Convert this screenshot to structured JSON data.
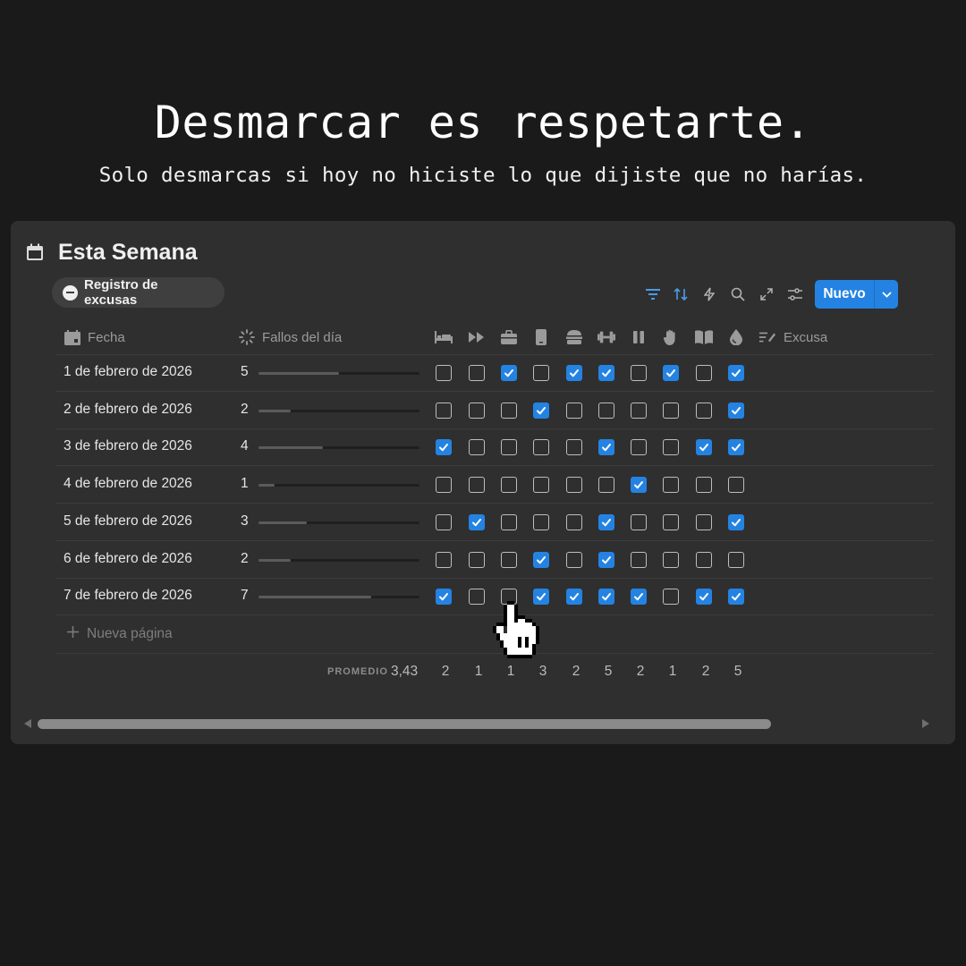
{
  "headline": "Desmarcar es respetarte.",
  "subline": "Solo desmarcas si hoy no hiciste lo que dijiste que no harías.",
  "database": {
    "title": "Esta Semana",
    "view_tab": "Registro de excusas",
    "new_button": "Nuevo",
    "icons": {
      "title": "calendar-icon",
      "view_tab": "minus-circle-icon"
    }
  },
  "toolbar": {
    "icons": [
      "filter-icon",
      "sort-icon",
      "lightning-icon",
      "search-icon",
      "expand-icon",
      "settings-sliders-icon"
    ]
  },
  "columns": {
    "date": "Fecha",
    "fails": "Fallos del día",
    "excuse": "Excusa",
    "habit_icons": [
      "bed-icon",
      "fast-forward-icon",
      "briefcase-icon",
      "phone-icon",
      "burger-icon",
      "dumbbell-icon",
      "pause-icon",
      "hand-icon",
      "book-icon",
      "drop-icon"
    ]
  },
  "rows": [
    {
      "date": "1 de febrero de 2026",
      "fails": "5",
      "fails_value": 5,
      "checks": [
        false,
        false,
        true,
        false,
        true,
        true,
        false,
        true,
        false,
        true
      ]
    },
    {
      "date": "2 de febrero de 2026",
      "fails": "2",
      "fails_value": 2,
      "checks": [
        false,
        false,
        false,
        true,
        false,
        false,
        false,
        false,
        false,
        true
      ]
    },
    {
      "date": "3 de febrero de 2026",
      "fails": "4",
      "fails_value": 4,
      "checks": [
        true,
        false,
        false,
        false,
        false,
        true,
        false,
        false,
        true,
        true
      ]
    },
    {
      "date": "4 de febrero de 2026",
      "fails": "1",
      "fails_value": 1,
      "checks": [
        false,
        false,
        false,
        false,
        false,
        false,
        true,
        false,
        false,
        false
      ]
    },
    {
      "date": "5 de febrero de 2026",
      "fails": "3",
      "fails_value": 3,
      "checks": [
        false,
        true,
        false,
        false,
        false,
        true,
        false,
        false,
        false,
        true
      ]
    },
    {
      "date": "6 de febrero de 2026",
      "fails": "2",
      "fails_value": 2,
      "checks": [
        false,
        false,
        false,
        true,
        false,
        true,
        false,
        false,
        false,
        false
      ]
    },
    {
      "date": "7 de febrero de 2026",
      "fails": "7",
      "fails_value": 7,
      "checks": [
        true,
        false,
        false,
        true,
        true,
        true,
        true,
        false,
        true,
        true
      ]
    }
  ],
  "fails_max": 10,
  "new_page": "Nueva página",
  "summary": {
    "label": "PROMEDIO",
    "average": "3,43",
    "column_totals": [
      "2",
      "1",
      "1",
      "3",
      "2",
      "5",
      "2",
      "1",
      "2",
      "5"
    ]
  },
  "colors": {
    "accent": "#2483e2",
    "background": "#1a1a1a",
    "panel": "#2f2f2f"
  }
}
